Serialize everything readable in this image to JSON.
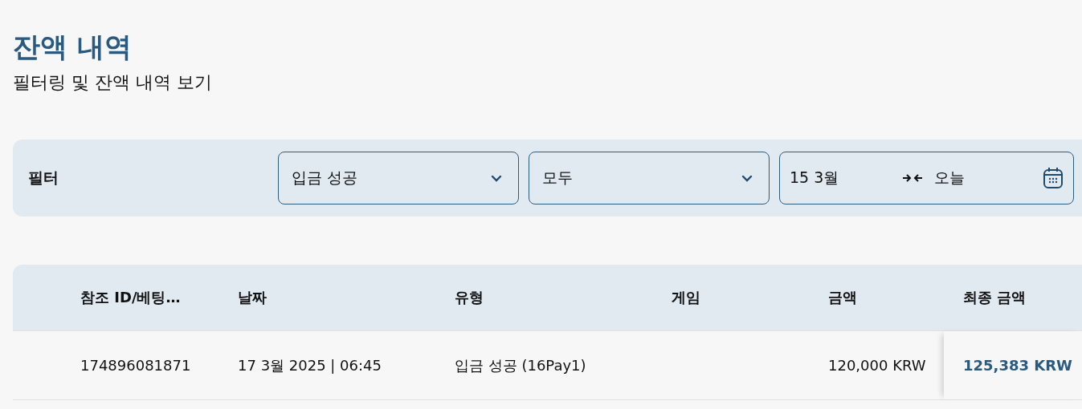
{
  "page": {
    "title": "잔액 내역",
    "subtitle": "필터링 및 잔액 내역 보기"
  },
  "filter": {
    "label": "필터",
    "selects": [
      {
        "value": "입금 성공"
      },
      {
        "value": "모두"
      }
    ],
    "date_range": {
      "from": "15 3월",
      "to": "오늘"
    }
  },
  "table": {
    "columns": [
      "참조 ID/베팅…",
      "날짜",
      "유형",
      "게임",
      "금액",
      "최종 금액"
    ],
    "rows": [
      {
        "cells": [
          "174896081871",
          "17 3월 2025 | 06:45",
          "입금 성공 (16Pay1)",
          "",
          "120,000 KRW",
          "125,383 KRW"
        ]
      }
    ]
  }
}
